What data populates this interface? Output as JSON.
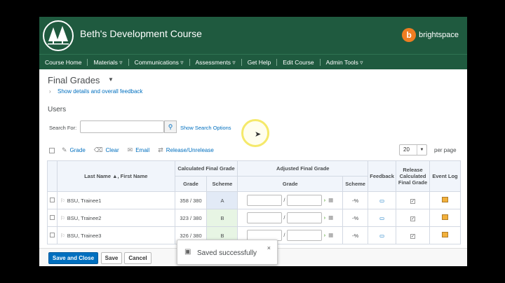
{
  "course": {
    "title": "Beth's Development Course",
    "brand": "brightspace"
  },
  "nav": {
    "items": [
      "Course Home",
      "Materials",
      "Communications",
      "Assessments",
      "Get Help",
      "Edit Course",
      "Admin Tools"
    ],
    "dropdown_flags": [
      false,
      true,
      true,
      true,
      false,
      false,
      true
    ]
  },
  "page": {
    "title": "Final Grades",
    "details_link": "Show details and overall feedback",
    "section": "Users"
  },
  "search": {
    "label": "Search For:",
    "value": "",
    "placeholder": "",
    "options_link": "Show Search Options"
  },
  "toolbar": {
    "grade": "Grade",
    "clear": "Clear",
    "email": "Email",
    "release": "Release/Unrelease",
    "per_page_value": "20",
    "per_page_label": "per page"
  },
  "table": {
    "headers": {
      "name": "Last Name ▲, First Name",
      "calculated": "Calculated Final Grade",
      "adjusted": "Adjusted Final Grade",
      "feedback": "Feedback",
      "release": "Release Calculated Final Grade",
      "event_log": "Event Log",
      "grade": "Grade",
      "scheme": "Scheme",
      "adj_grade": "Grade",
      "adj_scheme": "Scheme"
    },
    "rows": [
      {
        "name": "BSU, Trainee1",
        "grade": "358 / 380",
        "scheme": "A",
        "adj_scheme": "-%",
        "released": true
      },
      {
        "name": "BSU, Trainee2",
        "grade": "323 / 380",
        "scheme": "B",
        "adj_scheme": "-%",
        "released": true
      },
      {
        "name": "BSU, Trainee3",
        "grade": "326 / 380",
        "scheme": "B",
        "adj_scheme": "-%",
        "released": true
      }
    ],
    "slash": "/"
  },
  "footer": {
    "save_close": "Save and Close",
    "save": "Save",
    "cancel": "Cancel"
  },
  "toast": {
    "message": "Saved successfully",
    "close": "×"
  }
}
